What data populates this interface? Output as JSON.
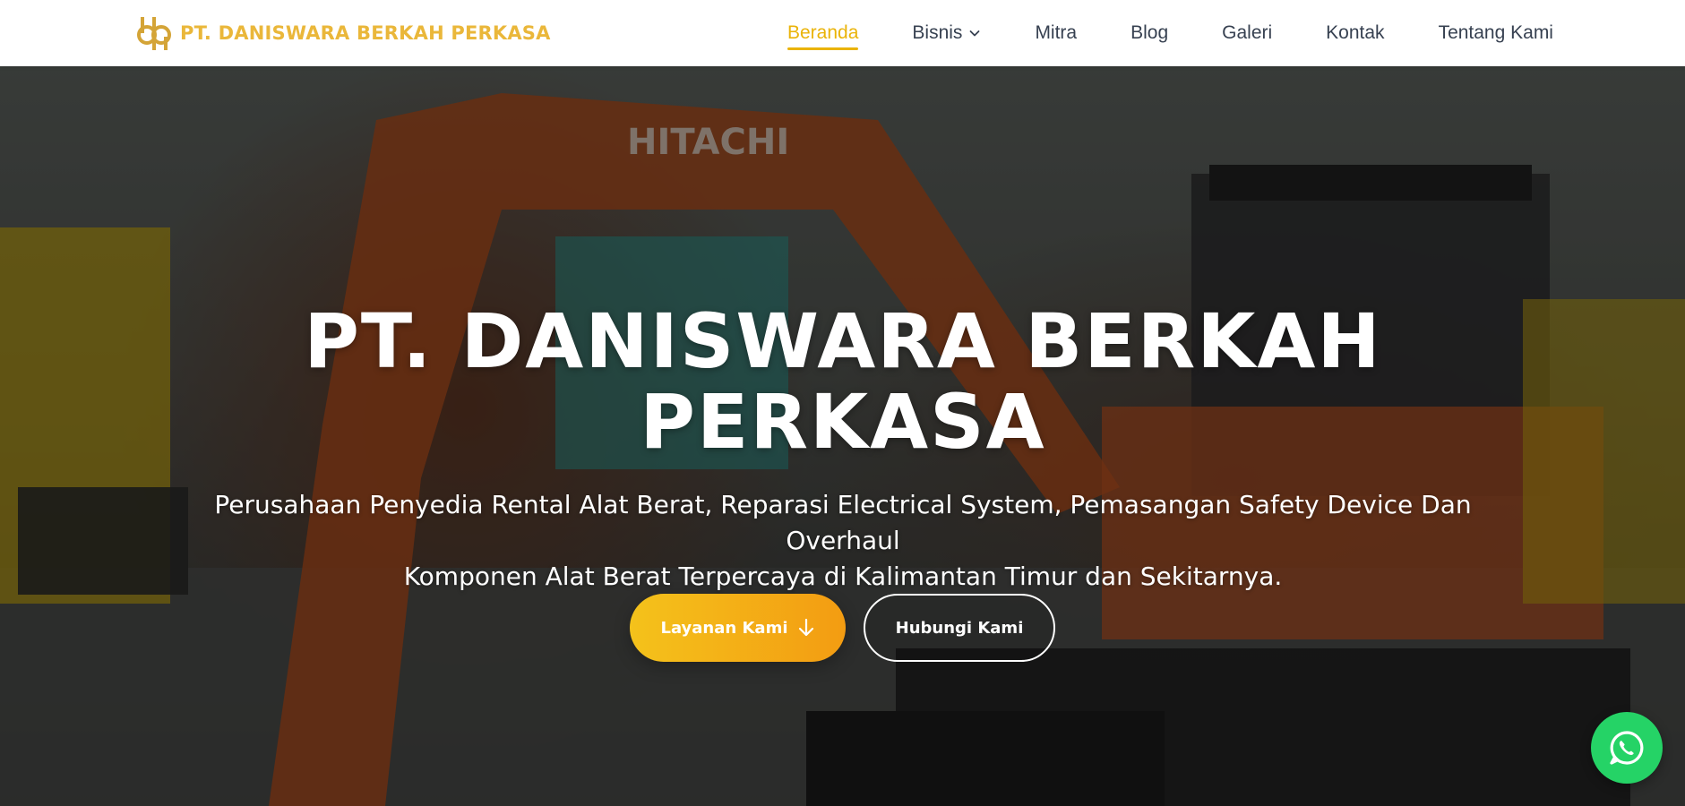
{
  "navbar": {
    "brand": {
      "name": "PT. DANISWARA BERKAH PERKASA",
      "logo_icon": "dbp-monogram-logo",
      "color": "#eab73a"
    },
    "items": [
      {
        "label": "Beranda",
        "active": true
      },
      {
        "label": "Bisnis",
        "has_dropdown": true
      },
      {
        "label": "Mitra"
      },
      {
        "label": "Blog"
      },
      {
        "label": "Galeri"
      },
      {
        "label": "Kontak"
      },
      {
        "label": "Tentang Kami"
      }
    ],
    "active_color": "#eab308"
  },
  "hero": {
    "title_line1": "PT. DANISWARA BERKAH",
    "title_line2": "PERKASA",
    "subtitle_line1": "Perusahaan Penyedia Rental Alat Berat, Reparasi Electrical System, Pemasangan Safety Device Dan Overhaul",
    "subtitle_line2": "Komponen Alat Berat Terpercaya di Kalimantan Timur dan Sekitarnya.",
    "background_image": "HITACHI",
    "primary_button": {
      "label": "Layanan Kami",
      "icon": "arrow-down-icon",
      "colors": [
        "#f4c21b",
        "#f39c12"
      ]
    },
    "secondary_button": {
      "label": "Hubungi Kami"
    }
  },
  "whatsapp": {
    "icon": "whatsapp-icon",
    "color": "#25d366"
  }
}
